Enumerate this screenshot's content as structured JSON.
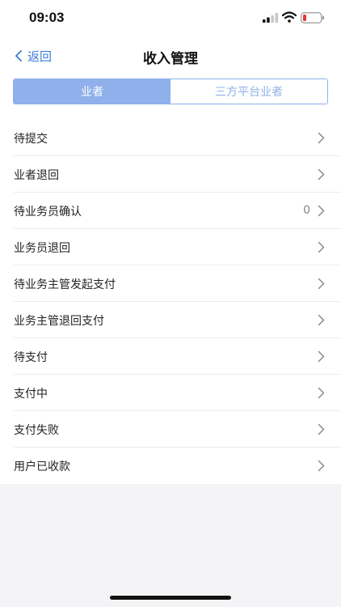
{
  "status_bar": {
    "time": "09:03"
  },
  "nav": {
    "back_label": "返回",
    "title": "收入管理"
  },
  "tabs": [
    {
      "label": "业者",
      "active": true
    },
    {
      "label": "三方平台业者",
      "active": false
    }
  ],
  "list_items": [
    {
      "label": "待提交",
      "count": ""
    },
    {
      "label": "业者退回",
      "count": ""
    },
    {
      "label": "待业务员确认",
      "count": "0"
    },
    {
      "label": "业务员退回",
      "count": ""
    },
    {
      "label": "待业务主管发起支付",
      "count": ""
    },
    {
      "label": "业务主管退回支付",
      "count": ""
    },
    {
      "label": "待支付",
      "count": ""
    },
    {
      "label": "支付中",
      "count": ""
    },
    {
      "label": "支付失败",
      "count": ""
    },
    {
      "label": "用户已收款",
      "count": ""
    }
  ],
  "colors": {
    "accent": "#3a7bd5",
    "segment_active": "#8fb0ea",
    "battery_low": "#e53935"
  },
  "icons": {
    "signal": "cellular-signal-icon",
    "wifi": "wifi-icon",
    "battery": "battery-icon",
    "back": "chevron-left-icon",
    "row": "chevron-right-icon"
  }
}
